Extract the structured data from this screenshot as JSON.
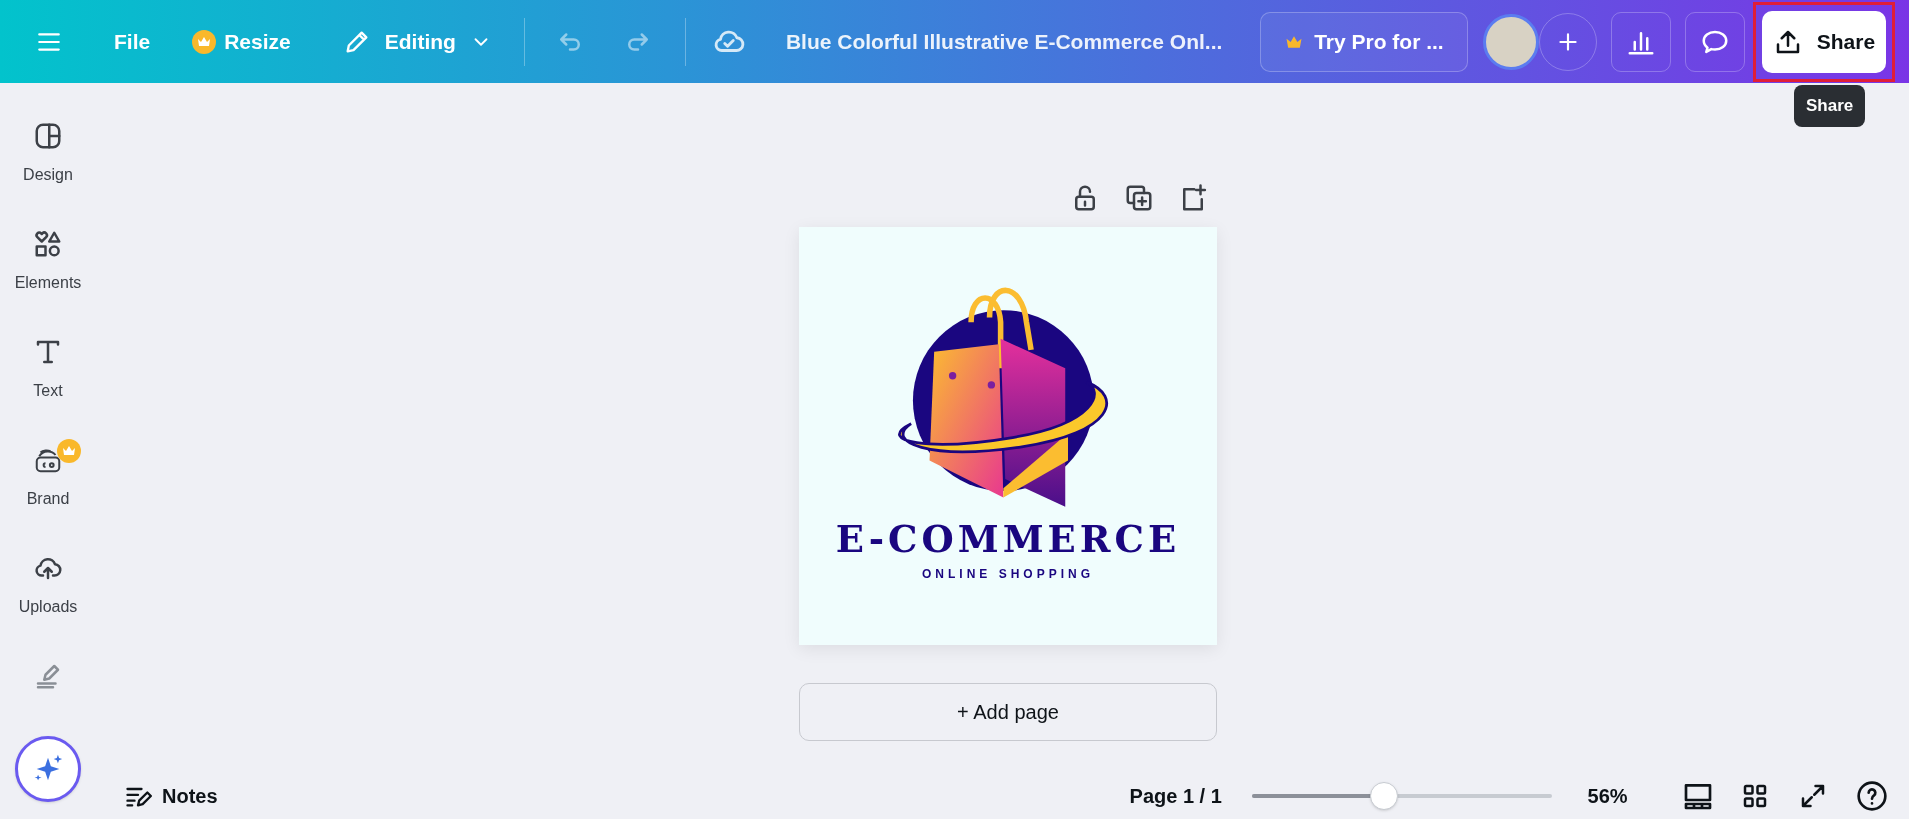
{
  "topbar": {
    "file": "File",
    "resize": "Resize",
    "mode": "Editing",
    "title": "Blue Colorful Illustrative E-Commerce Onl...",
    "try_pro": "Try Pro for ...",
    "share": "Share",
    "share_highlighted": true,
    "tooltip": "Share"
  },
  "sidebar": {
    "items": [
      {
        "kind": "design",
        "label": "Design",
        "pro": false
      },
      {
        "kind": "elements",
        "label": "Elements",
        "pro": false
      },
      {
        "kind": "text",
        "label": "Text",
        "pro": false
      },
      {
        "kind": "brand",
        "label": "Brand",
        "pro": true
      },
      {
        "kind": "uploads",
        "label": "Uploads",
        "pro": false
      },
      {
        "kind": "draw",
        "pro": false
      }
    ]
  },
  "canvas": {
    "headline": "E-COMMERCE",
    "tagline": "ONLINE SHOPPING",
    "add_page": "+ Add page"
  },
  "bottom_bar": {
    "notes": "Notes",
    "page": "Page 1 / 1",
    "zoom": {
      "level": 0.44,
      "reading": "56%"
    }
  }
}
